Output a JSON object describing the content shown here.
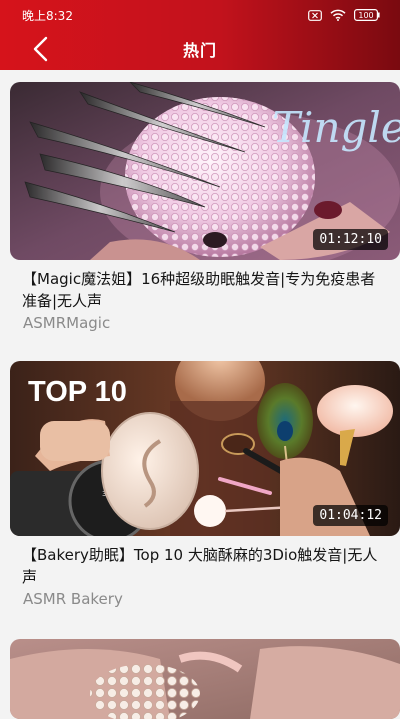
{
  "status_bar": {
    "time": "晚上8:32",
    "battery": "100"
  },
  "nav": {
    "title": "热门",
    "back_icon": "chevron-left-icon"
  },
  "videos": [
    {
      "title": "【Magic魔法姐】16种超级助眠触发音|专为免疫患者准备|无人声",
      "author": "ASMRMagic",
      "duration": "01:12:10",
      "thumbnail_text": "Tingle"
    },
    {
      "title": "【Bakery助眠】Top 10 大脑酥麻的3Dio触发音|无人声",
      "author": "ASMR Bakery",
      "duration": "01:04:12",
      "thumbnail_text": "TOP 10",
      "mic_label": "3DIO"
    }
  ],
  "colors": {
    "header_start": "#d6131b",
    "header_end": "#7a0a10",
    "author_text": "#8a8a8a"
  }
}
